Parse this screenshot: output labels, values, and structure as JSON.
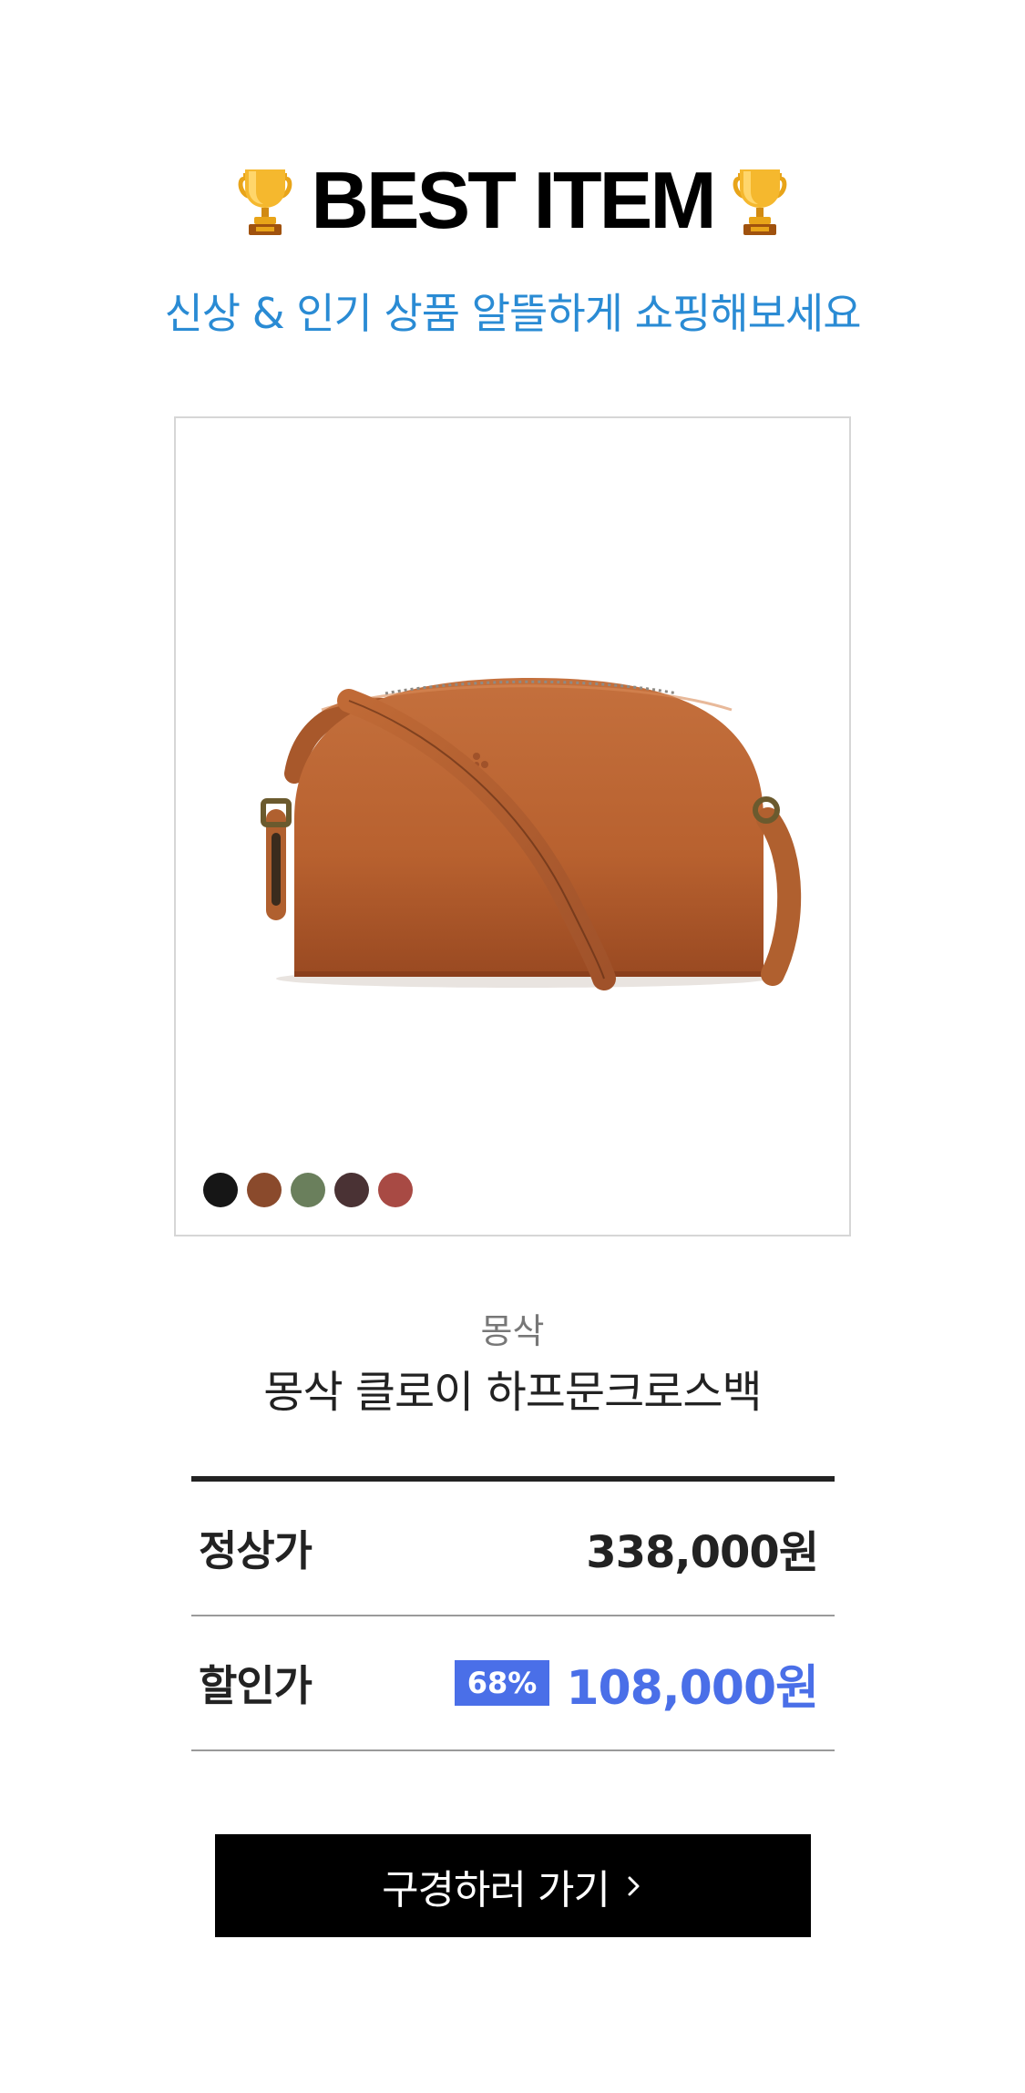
{
  "header": {
    "title": "BEST ITEM",
    "subtitle": "신상 & 인기 상품 알뜰하게 쇼핑해보세요",
    "left_icon": "trophy-icon",
    "right_icon": "trophy-icon"
  },
  "product": {
    "image_icon": "leather-crossbody-bag",
    "swatches": [
      "#161616",
      "#8a4a2c",
      "#6a7f5c",
      "#4a3234",
      "#a84a44"
    ],
    "brand": "몽삭",
    "name": "몽삭 클로이 하프문크로스백"
  },
  "prices": {
    "regular_label": "정상가",
    "regular_value": "338,000원",
    "sale_label": "할인가",
    "discount_badge": "68%",
    "sale_value": "108,000원",
    "accent_color": "#4a6fe8"
  },
  "cta": {
    "label": "구경하러 가기",
    "icon": "chevron-right-icon"
  }
}
